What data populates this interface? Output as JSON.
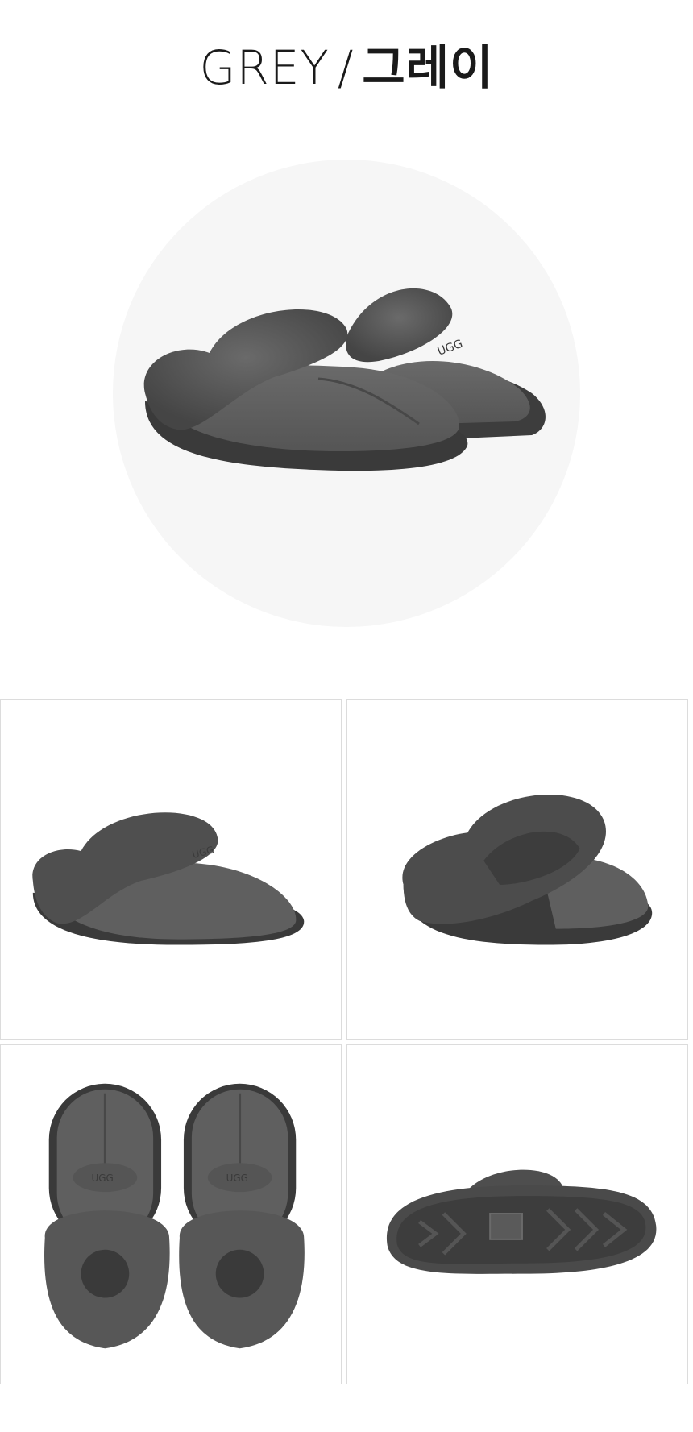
{
  "title": {
    "english": "GREY",
    "separator": "/",
    "korean": "그레이"
  },
  "colors": {
    "suede": "#5c5c5c",
    "fur": "#4d4d4d",
    "sole": "#3a3a3a",
    "circle": "#f6f6f6",
    "tile_border": "#dcdcdc"
  },
  "images": [
    {
      "view": "pair-angle"
    },
    {
      "view": "side"
    },
    {
      "view": "back"
    },
    {
      "view": "top"
    },
    {
      "view": "sole"
    }
  ]
}
